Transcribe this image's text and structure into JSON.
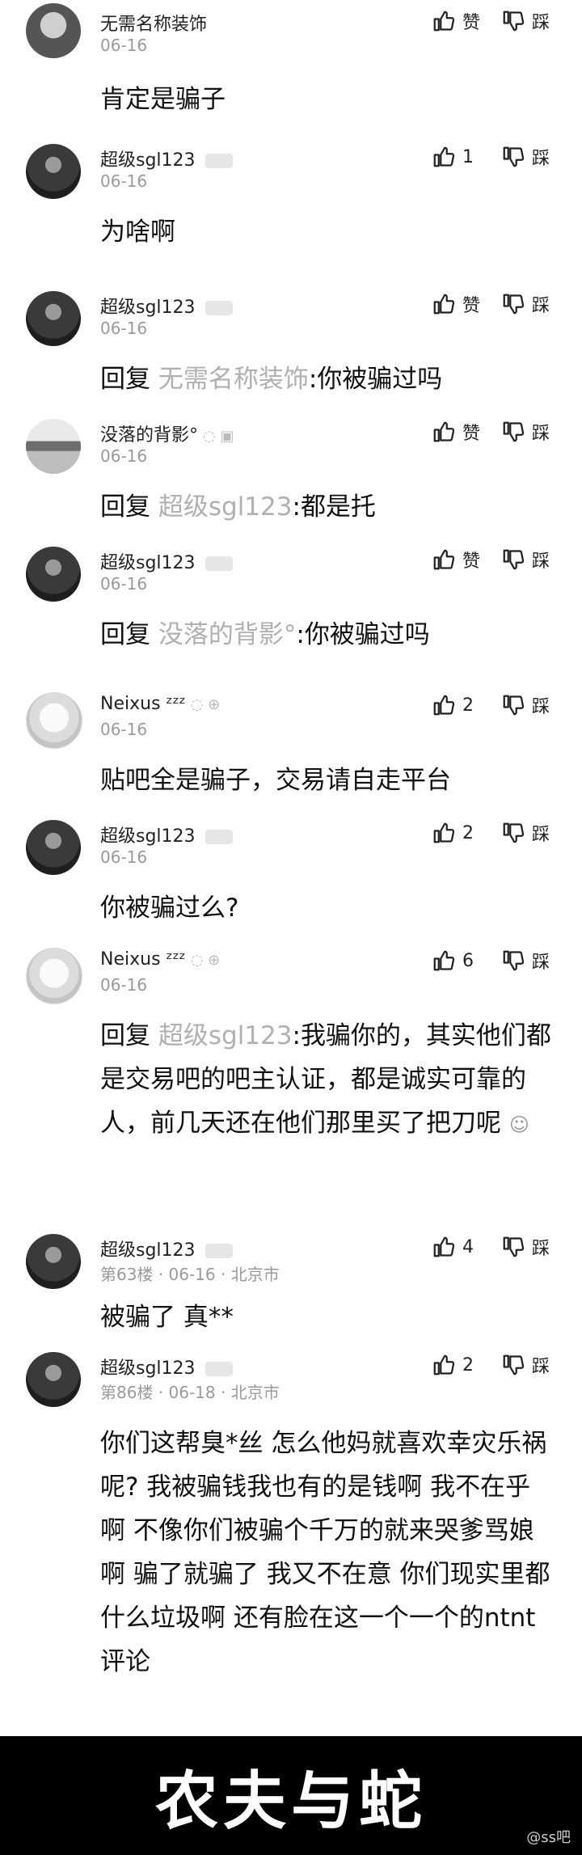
{
  "comments": [
    {
      "user": "无需名称装饰",
      "avatar": "gray",
      "meta": "06-16",
      "like_label": "赞",
      "dislike_label": "踩",
      "reply_label": "",
      "reply_to": "",
      "reply_sep": "",
      "text": "肯定是骗子"
    },
    {
      "user": "超级sgl123",
      "avatar": "dark",
      "meta": "06-16",
      "like_label": "1",
      "dislike_label": "踩",
      "reply_label": "",
      "reply_to": "",
      "reply_sep": "",
      "text": "为啥啊"
    },
    {
      "user": "超级sgl123",
      "avatar": "dark",
      "meta": "06-16",
      "like_label": "赞",
      "dislike_label": "踩",
      "reply_label": "回复",
      "reply_to": "无需名称装饰",
      "reply_sep": ":",
      "text": "你被骗过吗"
    },
    {
      "user": "没落的背影°",
      "avatar": "lake",
      "meta": "06-16",
      "like_label": "赞",
      "dislike_label": "踩",
      "reply_label": "回复",
      "reply_to": "超级sgl123",
      "reply_sep": ":",
      "text": "都是托"
    },
    {
      "user": "超级sgl123",
      "avatar": "dark",
      "meta": "06-16",
      "like_label": "赞",
      "dislike_label": "踩",
      "reply_label": "回复",
      "reply_to": "没落的背影°",
      "reply_sep": ":",
      "text": "你被骗过吗"
    },
    {
      "user": "Neixus ᶻᶻᶻ",
      "avatar": "anime",
      "meta": "06-16",
      "like_label": "2",
      "dislike_label": "踩",
      "reply_label": "",
      "reply_to": "",
      "reply_sep": "",
      "text": "贴吧全是骗子，交易请自走平台"
    },
    {
      "user": "超级sgl123",
      "avatar": "dark",
      "meta": "06-16",
      "like_label": "2",
      "dislike_label": "踩",
      "reply_label": "",
      "reply_to": "",
      "reply_sep": "",
      "text": "你被骗过么?"
    },
    {
      "user": "Neixus ᶻᶻᶻ",
      "avatar": "anime",
      "meta": "06-16",
      "like_label": "6",
      "dislike_label": "踩",
      "reply_label": "回复",
      "reply_to": "超级sgl123",
      "reply_sep": ":",
      "text": "我骗你的，其实他们都是交易吧的吧主认证，都是诚实可靠的人，前几天还在他们那里买了把刀呢"
    },
    {
      "user": "超级sgl123",
      "avatar": "dark",
      "meta": "第63楼 · 06-16 · 北京市",
      "like_label": "4",
      "dislike_label": "踩",
      "reply_label": "",
      "reply_to": "",
      "reply_sep": "",
      "text": "被骗了 真**"
    },
    {
      "user": "超级sgl123",
      "avatar": "dark",
      "meta": "第86楼 · 06-18 · 北京市",
      "like_label": "2",
      "dislike_label": "踩",
      "reply_label": "",
      "reply_to": "",
      "reply_sep": "",
      "text": "你们这帮臭*丝 怎么他妈就喜欢幸灾乐祸呢? 我被骗钱我也有的是钱啊 我不在乎啊 不像你们被骗个千万的就来哭爹骂娘啊 骗了就骗了 我又不在意 你们现实里都什么垃圾啊 还有脸在这一个一个的ntnt评论"
    }
  ],
  "caption": "农夫与蛇",
  "watermark": "@ss吧"
}
